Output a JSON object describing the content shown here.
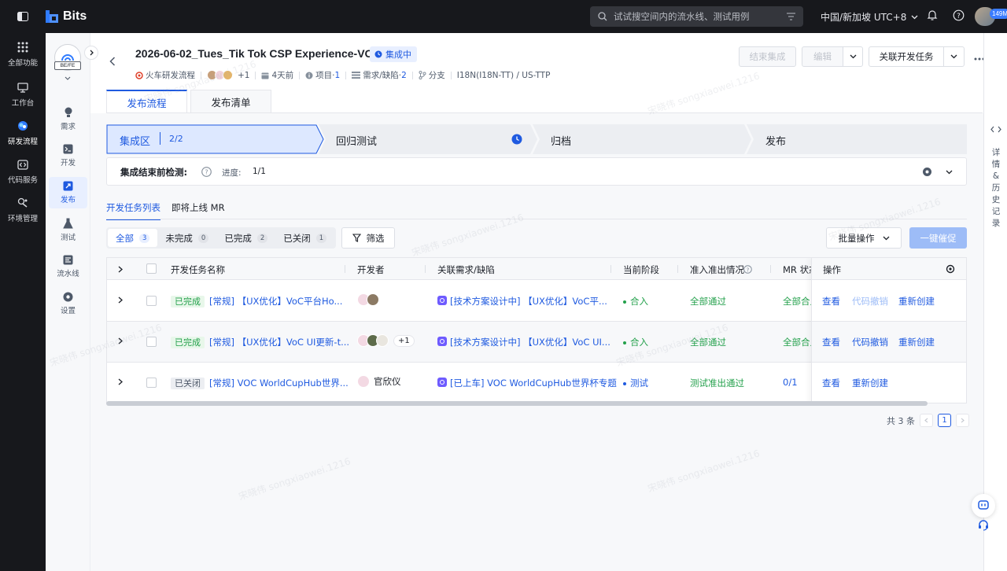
{
  "topbar": {
    "app_name": "Bits",
    "search_placeholder": "试试搜空间内的流水线、测试用例",
    "region": "中国/新加坡 UTC+8",
    "avatar_badge": "149M"
  },
  "dark_sidebar": {
    "items": [
      {
        "label": "全部功能",
        "icon": "grid-icon"
      },
      {
        "label": "工作台",
        "icon": "monitor-icon"
      },
      {
        "label": "研发流程",
        "icon": "flow-icon"
      },
      {
        "label": "代码服务",
        "icon": "code-icon"
      },
      {
        "label": "环境管理",
        "icon": "env-icon"
      }
    ]
  },
  "light_sidebar": {
    "project_tag": "BE/FE",
    "items": [
      {
        "label": "需求",
        "icon": "bulb-icon"
      },
      {
        "label": "开发",
        "icon": "terminal-icon"
      },
      {
        "label": "发布",
        "icon": "rocket-icon"
      },
      {
        "label": "测试",
        "icon": "flask-icon"
      },
      {
        "label": "流水线",
        "icon": "pipeline-icon"
      },
      {
        "label": "设置",
        "icon": "gear-icon"
      }
    ]
  },
  "header": {
    "title": "2026-06-02_Tues_Tik Tok CSP Experience-VOC",
    "status": "集成中",
    "meta": {
      "flow": "火车研发流程",
      "extra_members": "+1",
      "time": "4天前",
      "project_label": "项目·",
      "project_count": "1",
      "req_label": "需求/缺陷·",
      "req_count": "2",
      "branch": "分支",
      "region": "I18N(I18N-TT) / US-TTP"
    },
    "buttons": {
      "end_integration": "结束集成",
      "edit": "编辑",
      "link_task": "关联开发任务"
    }
  },
  "tabs": [
    "发布流程",
    "发布清单"
  ],
  "steps": [
    {
      "label": "集成区",
      "progress": "2/2"
    },
    {
      "label": "回归测试"
    },
    {
      "label": "归档"
    },
    {
      "label": "发布"
    }
  ],
  "precheck": {
    "label": "集成结束前检测:",
    "progress_label": "进度:",
    "progress": "1/1"
  },
  "subtabs": [
    "开发任务列表",
    "即将上线 MR"
  ],
  "filters": [
    {
      "label": "全部",
      "count": "3"
    },
    {
      "label": "未完成",
      "count": "0"
    },
    {
      "label": "已完成",
      "count": "2"
    },
    {
      "label": "已关闭",
      "count": "1"
    }
  ],
  "filter_button": "筛选",
  "batch_button": "批量操作",
  "urge_button": "一键催促",
  "table": {
    "columns": [
      "开发任务名称",
      "开发者",
      "关联需求/缺陷",
      "当前阶段",
      "准入准出情况",
      "MR 状态",
      "操作"
    ],
    "rows": [
      {
        "status": "已完成",
        "name": "[常规] 【UX优化】VoC平台Ho...",
        "developer": "",
        "developer_extra": "",
        "requirement": "[技术方案设计中] 【UX优化】VoC平...",
        "stage": "合入",
        "gate": "全部通过",
        "mr": "全部合入",
        "ops": [
          "查看",
          "代码撤销",
          "重新创建"
        ]
      },
      {
        "status": "已完成",
        "name": "[常规] 【UX优化】VoC UI更新-t...",
        "developer": "",
        "developer_extra": "+1",
        "requirement": "[技术方案设计中] 【UX优化】VoC UI...",
        "stage": "合入",
        "gate": "全部通过",
        "mr": "全部合入",
        "ops": [
          "查看",
          "代码撤销",
          "重新创建"
        ]
      },
      {
        "status": "已关闭",
        "name": "[常规] VOC WorldCupHub世界...",
        "developer": "官欣仪",
        "developer_extra": "",
        "requirement": "[已上车] VOC WorldCupHub世界杯专题",
        "stage": "测试",
        "gate": "测试准出通过",
        "mr": "0/1",
        "ops": [
          "查看",
          "重新创建"
        ]
      }
    ]
  },
  "pagination": {
    "total": "共 3 条",
    "current": "1"
  },
  "right_panel": {
    "label": "详情&历史记录"
  },
  "watermark": "宋晓伟 songxiaowei.1216",
  "colors": {
    "primary": "#1f5ae0",
    "success": "#23a04b",
    "topbar": "#17181c"
  }
}
